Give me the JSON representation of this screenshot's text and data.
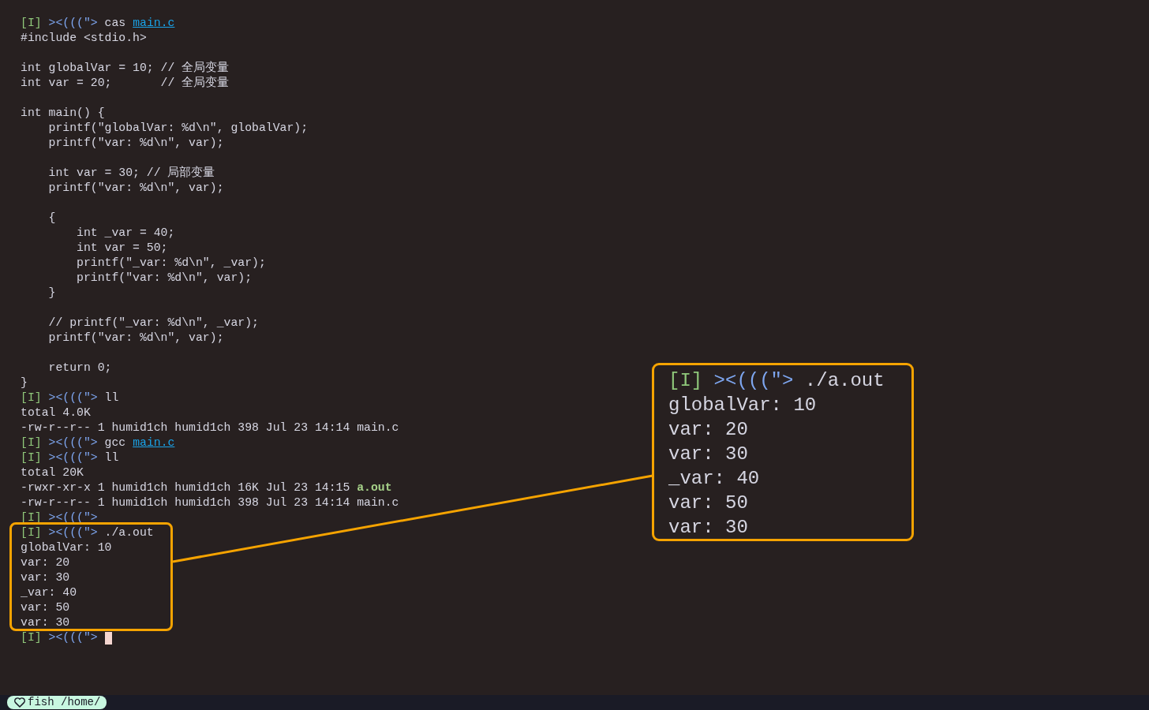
{
  "terminal": {
    "lines": [
      {
        "kind": "line",
        "segments": [
          {
            "kind": "mode",
            "text": "[I]"
          },
          {
            "kind": "prompt",
            "text": "><(((\">"
          },
          {
            "kind": "command",
            "text": "cas"
          },
          {
            "kind": "link",
            "text": "main.c"
          }
        ]
      },
      {
        "kind": "line",
        "segments": [
          {
            "kind": "code",
            "text": "#include <stdio.h>"
          }
        ]
      },
      {
        "kind": "blank"
      },
      {
        "kind": "line",
        "segments": [
          {
            "kind": "code",
            "text": "int globalVar = 10; // 全局变量"
          }
        ]
      },
      {
        "kind": "line",
        "segments": [
          {
            "kind": "code",
            "text": "int var = 20;       // 全局变量"
          }
        ]
      },
      {
        "kind": "blank"
      },
      {
        "kind": "line",
        "segments": [
          {
            "kind": "code",
            "text": "int main() {"
          }
        ]
      },
      {
        "kind": "line",
        "segments": [
          {
            "kind": "code",
            "text": "    printf(\"globalVar: %d\\n\", globalVar);"
          }
        ]
      },
      {
        "kind": "line",
        "segments": [
          {
            "kind": "code",
            "text": "    printf(\"var: %d\\n\", var);"
          }
        ]
      },
      {
        "kind": "blank"
      },
      {
        "kind": "line",
        "segments": [
          {
            "kind": "code",
            "text": "    int var = 30; // 局部变量"
          }
        ]
      },
      {
        "kind": "line",
        "segments": [
          {
            "kind": "code",
            "text": "    printf(\"var: %d\\n\", var);"
          }
        ]
      },
      {
        "kind": "blank"
      },
      {
        "kind": "line",
        "segments": [
          {
            "kind": "code",
            "text": "    {"
          }
        ]
      },
      {
        "kind": "line",
        "segments": [
          {
            "kind": "code",
            "text": "        int _var = 40;"
          }
        ]
      },
      {
        "kind": "line",
        "segments": [
          {
            "kind": "code",
            "text": "        int var = 50;"
          }
        ]
      },
      {
        "kind": "line",
        "segments": [
          {
            "kind": "code",
            "text": "        printf(\"_var: %d\\n\", _var);"
          }
        ]
      },
      {
        "kind": "line",
        "segments": [
          {
            "kind": "code",
            "text": "        printf(\"var: %d\\n\", var);"
          }
        ]
      },
      {
        "kind": "line",
        "segments": [
          {
            "kind": "code",
            "text": "    }"
          }
        ]
      },
      {
        "kind": "blank"
      },
      {
        "kind": "line",
        "segments": [
          {
            "kind": "code",
            "text": "    // printf(\"_var: %d\\n\", _var);"
          }
        ]
      },
      {
        "kind": "line",
        "segments": [
          {
            "kind": "code",
            "text": "    printf(\"var: %d\\n\", var);"
          }
        ]
      },
      {
        "kind": "blank"
      },
      {
        "kind": "line",
        "segments": [
          {
            "kind": "code",
            "text": "    return 0;"
          }
        ]
      },
      {
        "kind": "line",
        "segments": [
          {
            "kind": "code",
            "text": "}"
          }
        ]
      },
      {
        "kind": "line",
        "segments": [
          {
            "kind": "mode",
            "text": "[I]"
          },
          {
            "kind": "prompt",
            "text": "><(((\">"
          },
          {
            "kind": "command",
            "text": "ll"
          }
        ]
      },
      {
        "kind": "line",
        "segments": [
          {
            "kind": "output",
            "text": "total 4.0K"
          }
        ]
      },
      {
        "kind": "line",
        "segments": [
          {
            "kind": "output",
            "text": "-rw-r--r-- 1 humid1ch humid1ch 398 Jul 23 14:14 main.c"
          }
        ]
      },
      {
        "kind": "line",
        "segments": [
          {
            "kind": "mode",
            "text": "[I]"
          },
          {
            "kind": "prompt",
            "text": "><(((\">"
          },
          {
            "kind": "command",
            "text": "gcc"
          },
          {
            "kind": "link",
            "text": "main.c"
          }
        ]
      },
      {
        "kind": "line",
        "segments": [
          {
            "kind": "mode",
            "text": "[I]"
          },
          {
            "kind": "prompt",
            "text": "><(((\">"
          },
          {
            "kind": "command",
            "text": "ll"
          }
        ]
      },
      {
        "kind": "line",
        "segments": [
          {
            "kind": "output",
            "text": "total 20K"
          }
        ]
      },
      {
        "kind": "line",
        "segments": [
          {
            "kind": "output",
            "text": "-rwxr-xr-x 1 humid1ch humid1ch 16K Jul 23 14:15"
          },
          {
            "kind": "exec",
            "text": "a.out"
          }
        ]
      },
      {
        "kind": "line",
        "segments": [
          {
            "kind": "output",
            "text": "-rw-r--r-- 1 humid1ch humid1ch 398 Jul 23 14:14 main.c"
          }
        ]
      },
      {
        "kind": "line",
        "segments": [
          {
            "kind": "mode",
            "text": "[I]"
          },
          {
            "kind": "prompt",
            "text": "><(((\">"
          }
        ]
      },
      {
        "kind": "line",
        "segments": [
          {
            "kind": "mode",
            "text": "[I]"
          },
          {
            "kind": "prompt",
            "text": "><(((\">"
          },
          {
            "kind": "command",
            "text": "./a.out"
          }
        ]
      },
      {
        "kind": "line",
        "segments": [
          {
            "kind": "output",
            "text": "globalVar: 10"
          }
        ]
      },
      {
        "kind": "line",
        "segments": [
          {
            "kind": "output",
            "text": "var: 20"
          }
        ]
      },
      {
        "kind": "line",
        "segments": [
          {
            "kind": "output",
            "text": "var: 30"
          }
        ]
      },
      {
        "kind": "line",
        "segments": [
          {
            "kind": "output",
            "text": "_var: 40"
          }
        ]
      },
      {
        "kind": "line",
        "segments": [
          {
            "kind": "output",
            "text": "var: 50"
          }
        ]
      },
      {
        "kind": "line",
        "segments": [
          {
            "kind": "output",
            "text": "var: 30"
          }
        ]
      },
      {
        "kind": "line",
        "cursor": true,
        "segments": [
          {
            "kind": "mode",
            "text": "[I]"
          },
          {
            "kind": "prompt",
            "text": "><(((\">"
          }
        ]
      }
    ]
  },
  "magnifier": {
    "lines": [
      {
        "kind": "line",
        "segments": [
          {
            "kind": "mode",
            "text": "[I]"
          },
          {
            "kind": "prompt",
            "text": "><(((\">"
          },
          {
            "kind": "command",
            "text": "./a.out"
          }
        ]
      },
      {
        "kind": "line",
        "segments": [
          {
            "kind": "output",
            "text": "globalVar: 10"
          }
        ]
      },
      {
        "kind": "line",
        "segments": [
          {
            "kind": "output",
            "text": "var: 20"
          }
        ]
      },
      {
        "kind": "line",
        "segments": [
          {
            "kind": "output",
            "text": "var: 30"
          }
        ]
      },
      {
        "kind": "line",
        "segments": [
          {
            "kind": "output",
            "text": "_var: 40"
          }
        ]
      },
      {
        "kind": "line",
        "segments": [
          {
            "kind": "output",
            "text": "var: 50"
          }
        ]
      },
      {
        "kind": "line",
        "segments": [
          {
            "kind": "output",
            "text": "var: 30"
          }
        ]
      }
    ]
  },
  "status_bar": {
    "text": "fish /home/"
  }
}
